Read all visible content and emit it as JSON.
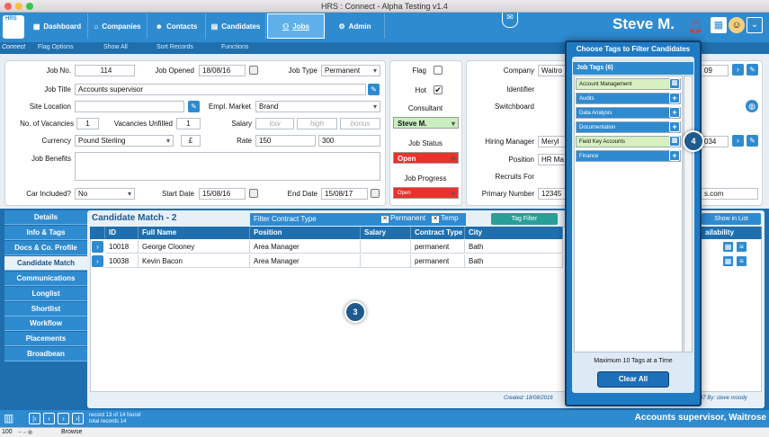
{
  "window": {
    "title": "HRS : Connect - Alpha Testing v1.4"
  },
  "logo": {
    "text": "HRS",
    "subtitle": "Connect"
  },
  "nav": {
    "items": [
      "Dashboard",
      "Companies",
      "Contacts",
      "Candidates",
      "Jobs",
      "Admin"
    ],
    "active": "Jobs",
    "user": "Steve M."
  },
  "subnav": {
    "items": [
      "Flag Options",
      "Show All",
      "Sort Records",
      "Functions"
    ]
  },
  "job": {
    "job_no_label": "Job No.",
    "job_no": "114",
    "job_opened_label": "Job Opened",
    "job_opened": "18/08/16",
    "job_type_label": "Job Type",
    "job_type": "Permanent",
    "job_title_label": "Job Title",
    "job_title": "Accounts supervisor",
    "site_location_label": "Site Location",
    "site_location": "",
    "empl_market_label": "Empl. Market",
    "empl_market": "Brand",
    "vacancies_label": "No. of Vacancies",
    "vacancies": "1",
    "unfilled_label": "Vacancies Unfilled",
    "unfilled": "1",
    "salary_label": "Salary",
    "salary_low": "low",
    "salary_high": "high",
    "salary_bonus": "bonus",
    "currency_label": "Currency",
    "currency": "Pound Sterling",
    "currency_symbol": "£",
    "rate_label": "Rate",
    "rate_low": "150",
    "rate_high": "300",
    "benefits_label": "Job Benefits",
    "benefits": "",
    "car_label": "Car Included?",
    "car": "No",
    "start_label": "Start Date",
    "start": "15/08/16",
    "end_label": "End Date",
    "end": "15/08/17"
  },
  "status": {
    "flag_label": "Flag",
    "hot_label": "Hot",
    "consultant_label": "Consultant",
    "consultant": "Steve M.",
    "job_status_label": "Job Status",
    "job_status": "Open",
    "job_progress_label": "Job Progress",
    "job_progress": "Open"
  },
  "company": {
    "company_label": "Company",
    "company": "Waitro",
    "identifier_label": "Identifier",
    "switchboard_label": "Switchboard",
    "hiring_manager_label": "Hiring Manager",
    "hiring_manager": "Meryl",
    "position_label": "Position",
    "position": "HR Ma",
    "recruits_for_label": "Recruits For",
    "primary_number_label": "Primary Number",
    "primary_number": "12345",
    "phone_tail_1": "09",
    "phone_tail_2": "034",
    "email_tail": "s.com"
  },
  "left_tabs": [
    "Details",
    "Info & Tags",
    "Docs & Co. Profile",
    "Candidate Match",
    "Communications",
    "Longlist",
    "Shortlist",
    "Workflow",
    "Placements",
    "Broadbean"
  ],
  "active_left_tab": "Candidate Match",
  "match": {
    "title": "Candidate Match - 2",
    "filter_title": "Filter Contract Type",
    "permanent": "Permanent",
    "temp": "Temp",
    "tag_filter": "Tag Filter",
    "show_in_list": "Show in List",
    "columns": [
      "ID",
      "Full Name",
      "Position",
      "Salary",
      "Contract Type",
      "City",
      "ailability"
    ],
    "rows": [
      {
        "id": "10018",
        "name": "George Clooney",
        "position": "Area Manager",
        "salary": "",
        "contract": "permanent",
        "city": "Bath"
      },
      {
        "id": "10038",
        "name": "Kevin Bacon",
        "position": "Area Manager",
        "salary": "",
        "contract": "permanent",
        "city": "Bath"
      }
    ],
    "created": "Created: 18/08/2016",
    "modified_tail": "47 By: steve moody",
    "marker": "3"
  },
  "popup": {
    "title": "Choose Tags to Filter Candidates",
    "job_tags_header": "Job Tags (6)",
    "tags": [
      {
        "name": "Account Management",
        "selected": true
      },
      {
        "name": "Audits",
        "selected": false
      },
      {
        "name": "Data Analysis",
        "selected": false
      },
      {
        "name": "Documentation",
        "selected": false
      },
      {
        "name": "Field Key Accounts",
        "selected": true
      },
      {
        "name": "Finance",
        "selected": false
      }
    ],
    "footer": "Maximum 10 Tags at a Time",
    "clear_all": "Clear All",
    "marker": "4"
  },
  "footer": {
    "record": "record 13 of 14 found",
    "total": "total records 14",
    "title": "Accounts supervisor, Waitrose",
    "zoom": "100",
    "mode": "Browse"
  },
  "colors": {
    "accent": "#2f8bd0",
    "dark": "#1f6fae",
    "selected_tag": "#d8f0c0",
    "status_red": "#e8322c",
    "consultant_green": "#c9efc0"
  }
}
